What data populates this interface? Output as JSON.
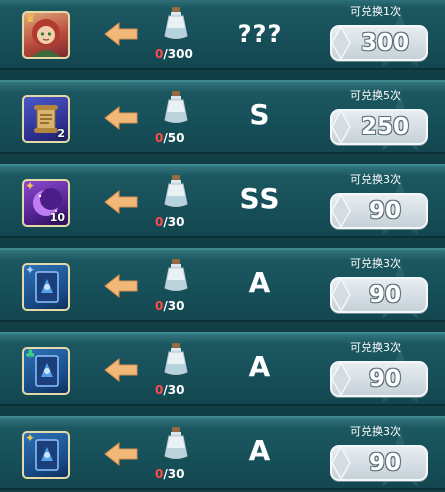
{
  "colors": {
    "row_bg": "#17505a",
    "progress_current": "#ff4b4b",
    "arrow": "#f2b87a",
    "price_box": "#d8e1e6"
  },
  "rows": [
    {
      "item_icon": "portrait-icon",
      "item_count": "",
      "progress_current": "0",
      "progress_total": "/300",
      "grade": "???",
      "limit": "可兑换1次",
      "price": "300"
    },
    {
      "item_icon": "scroll-icon",
      "item_count": "2",
      "progress_current": "0",
      "progress_total": "/50",
      "grade": "S",
      "limit": "可兑换5次",
      "price": "250"
    },
    {
      "item_icon": "moon-icon",
      "item_count": "10",
      "progress_current": "0",
      "progress_total": "/30",
      "grade": "SS",
      "limit": "可兑换3次",
      "price": "90"
    },
    {
      "item_icon": "card-icon",
      "item_count": "",
      "progress_current": "0",
      "progress_total": "/30",
      "grade": "A",
      "limit": "可兑换3次",
      "price": "90"
    },
    {
      "item_icon": "card-icon",
      "item_count": "",
      "progress_current": "0",
      "progress_total": "/30",
      "grade": "A",
      "limit": "可兑换3次",
      "price": "90"
    },
    {
      "item_icon": "card-icon",
      "item_count": "",
      "progress_current": "0",
      "progress_total": "/30",
      "grade": "A",
      "limit": "可兑换3次",
      "price": "90"
    }
  ]
}
